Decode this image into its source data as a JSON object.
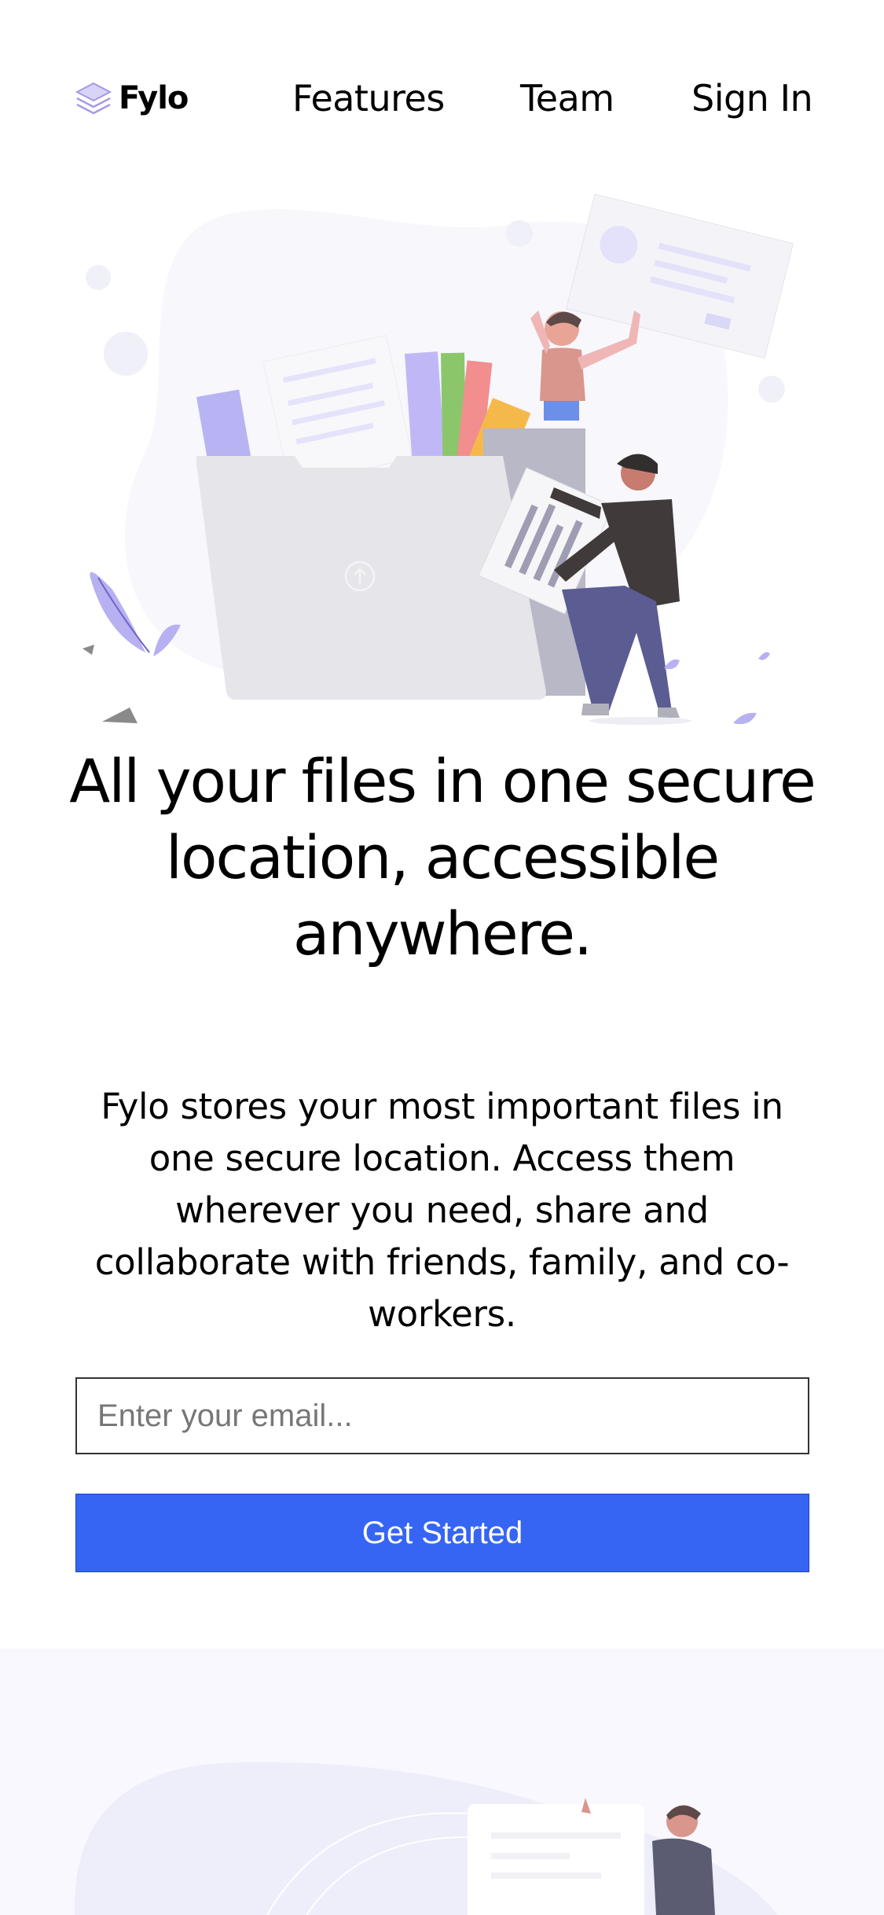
{
  "brand": {
    "name": "Fylo",
    "logo_icon": "layers-icon",
    "accent": "#3665f3"
  },
  "nav": {
    "features": "Features",
    "team": "Team",
    "signin": "Sign In"
  },
  "hero": {
    "headline": "All your files in one secure location, accessible anywhere.",
    "subtext": "Fylo stores your most important files in one secure location. Access them wherever you need, share and collaborate with friends, family, and co-workers.",
    "email_placeholder": "Enter your email...",
    "cta_label": "Get Started"
  }
}
